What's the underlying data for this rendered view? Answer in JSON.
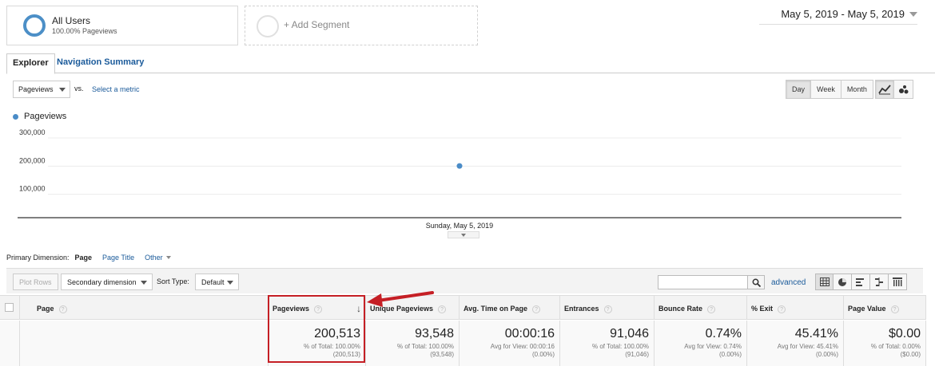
{
  "segments": {
    "all_users": {
      "name": "All Users",
      "sub": "100.00% Pageviews"
    },
    "add_label": "+ Add Segment"
  },
  "date_range": "May 5, 2019 - May 5, 2019",
  "tabs": [
    "Explorer",
    "Navigation Summary"
  ],
  "metric": {
    "selected": "Pageviews",
    "vs": "vs.",
    "select_link": "Select a metric"
  },
  "time_buttons": [
    "Day",
    "Week",
    "Month"
  ],
  "legend_label": "Pageviews",
  "chart_data": {
    "type": "line",
    "series": [
      {
        "name": "Pageviews",
        "x": [
          "Sunday, May 5, 2019"
        ],
        "y": [
          200513
        ]
      }
    ],
    "yticks": [
      "300,000",
      "200,000",
      "100,000"
    ],
    "ylim": [
      0,
      300000
    ],
    "xlabel_tick": "Sunday, May 5, 2019",
    "grid": true,
    "color": "#4a8cc7"
  },
  "primary_dimension": {
    "label": "Primary Dimension:",
    "current": "Page",
    "page_title": "Page Title",
    "other": "Other"
  },
  "controls": {
    "plot_rows": "Plot Rows",
    "secondary": "Secondary dimension",
    "sort_label": "Sort Type:",
    "sort_value": "Default",
    "advanced": "advanced"
  },
  "table": {
    "headers": [
      "Page",
      "Pageviews",
      "Unique Pageviews",
      "Avg. Time on Page",
      "Entrances",
      "Bounce Rate",
      "% Exit",
      "Page Value"
    ],
    "totals": [
      {
        "value": "200,513",
        "sub1": "% of Total: 100.00%",
        "sub2": "(200,513)"
      },
      {
        "value": "93,548",
        "sub1": "% of Total: 100.00%",
        "sub2": "(93,548)"
      },
      {
        "value": "00:00:16",
        "sub1": "Avg for View: 00:00:16",
        "sub2": "(0.00%)"
      },
      {
        "value": "91,046",
        "sub1": "% of Total: 100.00%",
        "sub2": "(91,046)"
      },
      {
        "value": "0.74%",
        "sub1": "Avg for View: 0.74%",
        "sub2": "(0.00%)"
      },
      {
        "value": "45.41%",
        "sub1": "Avg for View: 45.41%",
        "sub2": "(0.00%)"
      },
      {
        "value": "$0.00",
        "sub1": "% of Total: 0.00%",
        "sub2": "($0.00)"
      }
    ]
  }
}
